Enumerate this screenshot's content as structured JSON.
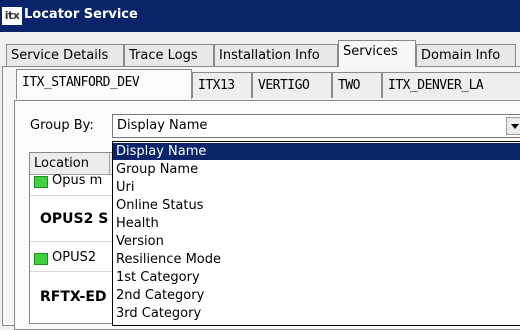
{
  "window": {
    "logo": "itx",
    "title": "Locator Service"
  },
  "tabs": [
    {
      "label": "Service Details"
    },
    {
      "label": "Trace Logs"
    },
    {
      "label": "Installation Info"
    },
    {
      "label": "Services"
    },
    {
      "label": "Domain Info"
    }
  ],
  "active_tab": "Services",
  "subtabs": [
    {
      "label": "ITX_STANFORD_DEV"
    },
    {
      "label": "ITX13"
    },
    {
      "label": "VERTIGO"
    },
    {
      "label": "TWO"
    },
    {
      "label": "ITX_DENVER_LA"
    }
  ],
  "active_subtab": "ITX_STANFORD_DEV",
  "group_by": {
    "label": "Group By:",
    "value": "Display Name"
  },
  "grid": {
    "column_header": "Location",
    "rows": [
      {
        "text": "Opus m",
        "status": "online"
      },
      {
        "text": "OPUS2 S",
        "bold": true
      },
      {
        "text": "OPUS2",
        "status": "online"
      },
      {
        "text": "RFTX-ED",
        "bold": true
      }
    ]
  },
  "dropdown": {
    "options": [
      "Display Name",
      "Group Name",
      "Uri",
      "Online Status",
      "Health",
      "Version",
      "Resilience Mode",
      "1st Category",
      "2nd Category",
      "3rd Category"
    ],
    "selected": "Display Name"
  },
  "colors": {
    "titlebar": "#0a246a",
    "selection": "#0a246a",
    "status_green": "#3fd13f"
  }
}
